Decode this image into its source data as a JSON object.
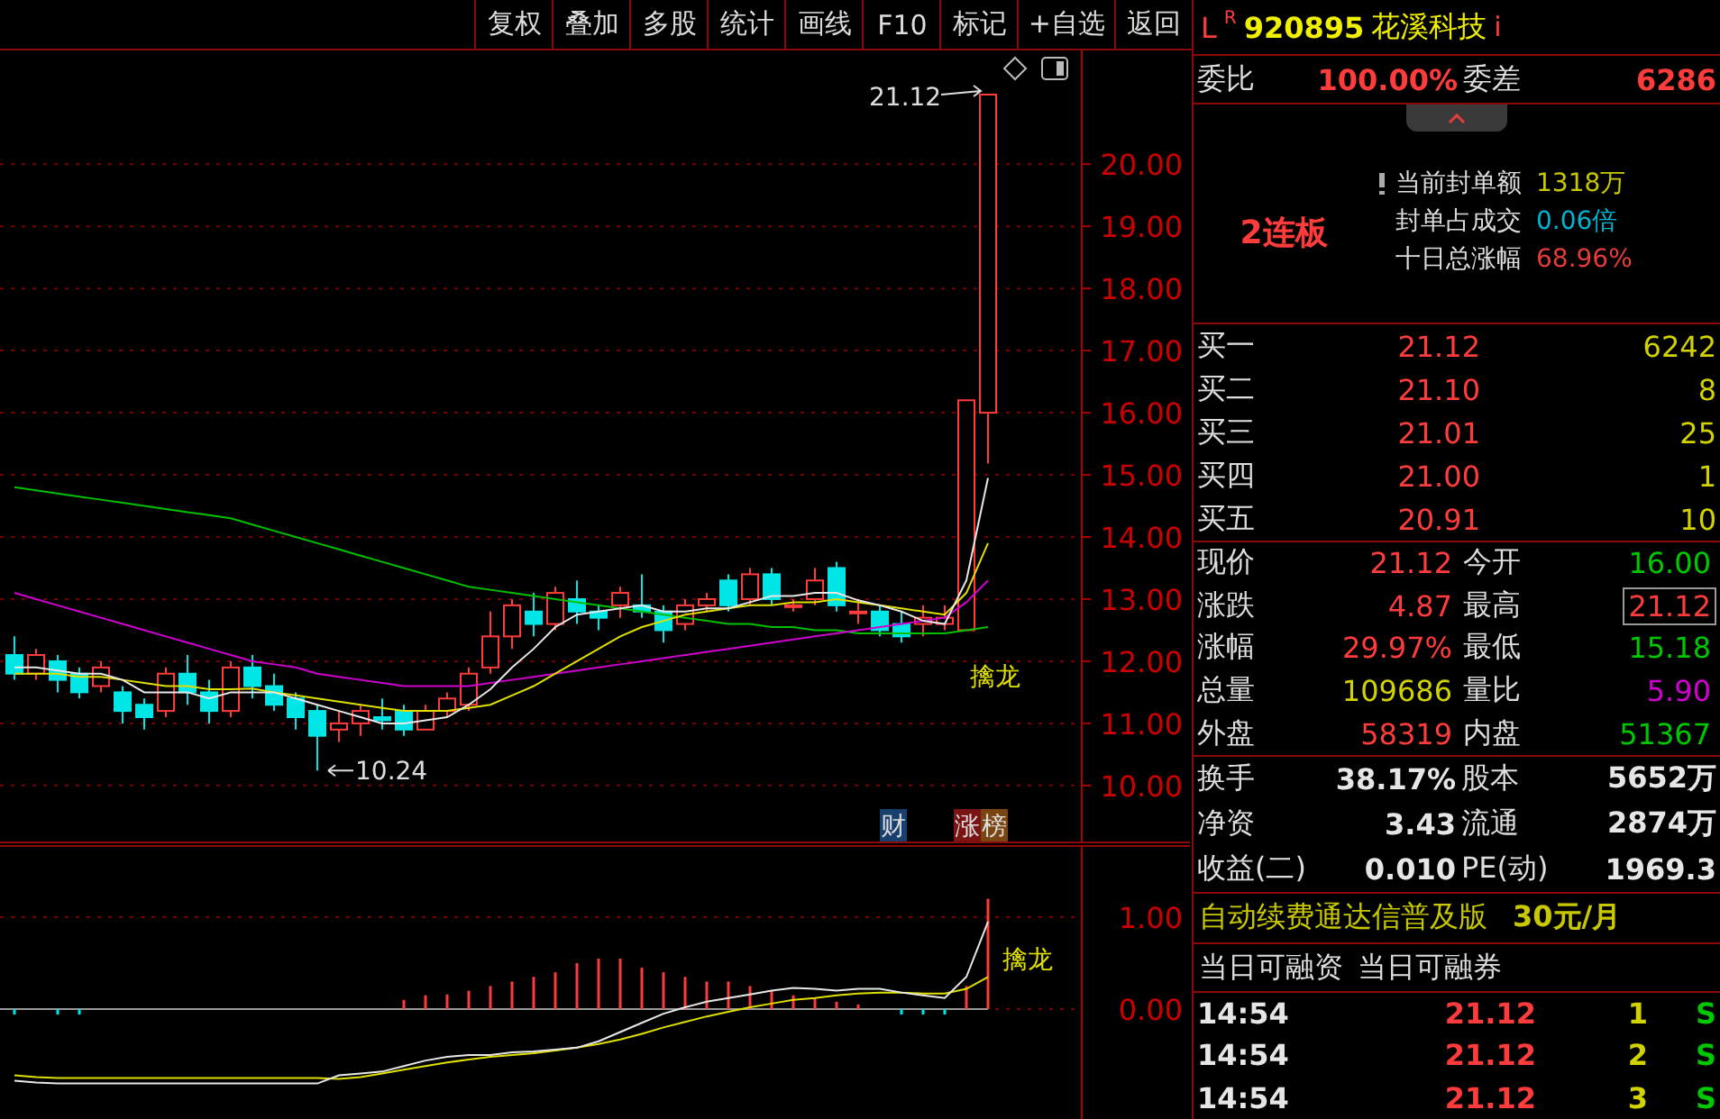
{
  "toolbar": {
    "buttons": [
      "复权",
      "叠加",
      "多股",
      "统计",
      "画线",
      "F10",
      "标记",
      "+自选",
      "返回"
    ]
  },
  "main_chart": {
    "high_label": "21.12",
    "low_label": "10.24",
    "signal": "擒龙",
    "badges": [
      {
        "text": "财",
        "color": "#17406e"
      },
      {
        "text": "涨",
        "color": "#7a1414"
      },
      {
        "text": "榜",
        "color": "#7a4510"
      }
    ],
    "chart_data": {
      "type": "candlestick",
      "ylim": [
        9.07,
        21.83
      ],
      "grid": true,
      "yticks": [
        {
          "value": 20,
          "label": "20.00"
        },
        {
          "value": 19,
          "label": "19.00"
        },
        {
          "value": 18,
          "label": "18.00"
        },
        {
          "value": 17,
          "label": "17.00"
        },
        {
          "value": 16,
          "label": "16.00"
        },
        {
          "value": 15,
          "label": "15.00"
        },
        {
          "value": 14,
          "label": "14.00"
        },
        {
          "value": 13,
          "label": "13.00"
        },
        {
          "value": 12,
          "label": "12.00"
        },
        {
          "value": 11,
          "label": "11.00"
        },
        {
          "value": 10,
          "label": "10.00"
        }
      ],
      "ohlc": [
        [
          12.1,
          12.4,
          11.7,
          11.8
        ],
        [
          11.8,
          12.2,
          11.7,
          12.1
        ],
        [
          12.0,
          12.1,
          11.5,
          11.7
        ],
        [
          11.8,
          11.9,
          11.4,
          11.5
        ],
        [
          11.6,
          12.0,
          11.5,
          11.9
        ],
        [
          11.5,
          11.6,
          11.0,
          11.2
        ],
        [
          11.3,
          11.4,
          10.9,
          11.1
        ],
        [
          11.2,
          11.9,
          11.1,
          11.8
        ],
        [
          11.8,
          12.1,
          11.3,
          11.5
        ],
        [
          11.5,
          11.7,
          11.0,
          11.2
        ],
        [
          11.2,
          12.0,
          11.1,
          11.9
        ],
        [
          11.9,
          12.1,
          11.4,
          11.6
        ],
        [
          11.6,
          11.8,
          11.2,
          11.3
        ],
        [
          11.4,
          11.5,
          10.9,
          11.1
        ],
        [
          11.2,
          11.3,
          10.24,
          10.8
        ],
        [
          10.9,
          11.2,
          10.7,
          11.0
        ],
        [
          11.0,
          11.3,
          10.8,
          11.2
        ],
        [
          11.1,
          11.4,
          10.9,
          11.05
        ],
        [
          11.2,
          11.3,
          10.8,
          10.9
        ],
        [
          10.9,
          11.3,
          10.9,
          11.2
        ],
        [
          11.2,
          11.5,
          11.1,
          11.4
        ],
        [
          11.3,
          11.9,
          11.2,
          11.8
        ],
        [
          11.9,
          12.8,
          11.8,
          12.4
        ],
        [
          12.4,
          13.0,
          12.2,
          12.9
        ],
        [
          12.8,
          13.1,
          12.4,
          12.6
        ],
        [
          12.6,
          13.2,
          12.5,
          13.1
        ],
        [
          13.0,
          13.3,
          12.6,
          12.8
        ],
        [
          12.8,
          12.9,
          12.5,
          12.7
        ],
        [
          12.9,
          13.2,
          12.7,
          13.1
        ],
        [
          12.9,
          13.4,
          12.7,
          12.8
        ],
        [
          12.8,
          12.9,
          12.3,
          12.5
        ],
        [
          12.6,
          13.0,
          12.5,
          12.9
        ],
        [
          12.9,
          13.1,
          12.8,
          13.0
        ],
        [
          13.3,
          13.4,
          12.8,
          12.9
        ],
        [
          13.0,
          13.5,
          12.9,
          13.4
        ],
        [
          13.4,
          13.5,
          12.9,
          13.0
        ],
        [
          12.9,
          13.0,
          12.8,
          12.9
        ],
        [
          13.0,
          13.5,
          12.9,
          13.3
        ],
        [
          13.5,
          13.6,
          12.8,
          12.9
        ],
        [
          12.8,
          13.0,
          12.6,
          12.8
        ],
        [
          12.8,
          12.9,
          12.4,
          12.5
        ],
        [
          12.6,
          12.8,
          12.3,
          12.4
        ],
        [
          12.6,
          12.9,
          12.4,
          12.7
        ],
        [
          12.6,
          12.9,
          12.5,
          12.7
        ],
        [
          12.5,
          16.2,
          12.5,
          16.2
        ],
        [
          16.0,
          21.12,
          15.18,
          21.12
        ]
      ],
      "series": [
        {
          "type": "line",
          "color": "#00c000",
          "values": [
            14.8,
            14.75,
            14.7,
            14.65,
            14.6,
            14.55,
            14.5,
            14.45,
            14.4,
            14.35,
            14.3,
            14.2,
            14.1,
            14.0,
            13.9,
            13.8,
            13.7,
            13.6,
            13.5,
            13.4,
            13.3,
            13.2,
            13.15,
            13.1,
            13.05,
            13.0,
            12.95,
            12.9,
            12.85,
            12.8,
            12.75,
            12.7,
            12.65,
            12.6,
            12.6,
            12.55,
            12.55,
            12.5,
            12.5,
            12.45,
            12.45,
            12.45,
            12.45,
            12.45,
            12.5,
            12.55
          ]
        },
        {
          "type": "line",
          "color": "#d000d0",
          "values": [
            13.1,
            13.0,
            12.9,
            12.8,
            12.7,
            12.6,
            12.5,
            12.4,
            12.3,
            12.2,
            12.1,
            12.0,
            11.95,
            11.9,
            11.8,
            11.75,
            11.7,
            11.65,
            11.6,
            11.6,
            11.6,
            11.6,
            11.65,
            11.7,
            11.75,
            11.8,
            11.85,
            11.9,
            11.95,
            12.0,
            12.05,
            12.1,
            12.15,
            12.2,
            12.25,
            12.3,
            12.35,
            12.4,
            12.45,
            12.5,
            12.55,
            12.6,
            12.65,
            12.7,
            12.95,
            13.3
          ]
        },
        {
          "type": "line",
          "color": "#e0e000",
          "values": [
            11.8,
            11.8,
            11.8,
            11.75,
            11.75,
            11.7,
            11.65,
            11.6,
            11.6,
            11.55,
            11.55,
            11.56,
            11.5,
            11.45,
            11.4,
            11.35,
            11.3,
            11.25,
            11.2,
            11.2,
            11.2,
            11.25,
            11.3,
            11.45,
            11.6,
            11.8,
            12.0,
            12.2,
            12.4,
            12.55,
            12.65,
            12.75,
            12.8,
            12.85,
            12.9,
            12.9,
            12.95,
            12.95,
            13.0,
            12.95,
            12.9,
            12.85,
            12.8,
            12.75,
            13.1,
            13.9
          ]
        },
        {
          "type": "line",
          "color": "#e8e8e8",
          "values": [
            11.9,
            11.9,
            11.85,
            11.8,
            11.8,
            11.7,
            11.5,
            11.5,
            11.5,
            11.4,
            11.5,
            11.5,
            11.5,
            11.4,
            11.3,
            11.2,
            11.1,
            11.0,
            11.0,
            11.05,
            11.1,
            11.3,
            11.55,
            11.9,
            12.2,
            12.55,
            12.75,
            12.8,
            12.85,
            12.9,
            12.8,
            12.8,
            12.85,
            12.85,
            12.95,
            13.05,
            13.05,
            13.1,
            13.1,
            12.98,
            12.9,
            12.8,
            12.65,
            12.6,
            13.3,
            14.95
          ]
        }
      ]
    }
  },
  "sub_chart": {
    "signal": "擒龙",
    "chart_data": {
      "type": "line",
      "ylim": [
        -1.196,
        1.784
      ],
      "grid": true,
      "yticks": [
        {
          "value": 1,
          "label": "1.00"
        },
        {
          "value": 0,
          "label": "0.00"
        }
      ],
      "series": [
        {
          "type": "bar",
          "color": "#ff3c3c",
          "values": [
            null,
            null,
            null,
            null,
            null,
            null,
            null,
            null,
            null,
            null,
            null,
            null,
            null,
            null,
            null,
            null,
            null,
            null,
            0.1,
            0.15,
            0.16,
            0.2,
            0.25,
            0.3,
            0.35,
            0.4,
            0.5,
            0.55,
            0.55,
            0.45,
            0.4,
            0.35,
            0.3,
            0.3,
            0.25,
            0.2,
            0.15,
            0.12,
            0.08,
            0.05,
            null,
            null,
            null,
            null,
            0.25,
            1.2
          ]
        },
        {
          "type": "bar",
          "color": "#00e5e5",
          "values": [
            -0.06,
            null,
            -0.06,
            -0.06,
            null,
            null,
            null,
            null,
            null,
            null,
            null,
            null,
            null,
            null,
            null,
            null,
            null,
            null,
            null,
            null,
            null,
            null,
            null,
            null,
            null,
            null,
            null,
            null,
            null,
            null,
            null,
            null,
            null,
            null,
            null,
            null,
            null,
            null,
            null,
            null,
            null,
            -0.06,
            -0.06,
            -0.06,
            null,
            null
          ]
        },
        {
          "type": "line",
          "color": "#e0e000",
          "values": [
            -0.72,
            -0.74,
            -0.75,
            -0.75,
            -0.75,
            -0.75,
            -0.75,
            -0.75,
            -0.75,
            -0.75,
            -0.75,
            -0.75,
            -0.75,
            -0.75,
            -0.75,
            -0.76,
            -0.74,
            -0.7,
            -0.66,
            -0.62,
            -0.58,
            -0.55,
            -0.52,
            -0.5,
            -0.48,
            -0.45,
            -0.42,
            -0.38,
            -0.33,
            -0.27,
            -0.2,
            -0.14,
            -0.08,
            -0.03,
            0.02,
            0.06,
            0.1,
            0.12,
            0.15,
            0.17,
            0.18,
            0.18,
            0.17,
            0.17,
            0.22,
            0.35
          ]
        },
        {
          "type": "line",
          "color": "#e8e8e8",
          "values": [
            -0.78,
            -0.8,
            -0.81,
            -0.81,
            -0.81,
            -0.81,
            -0.81,
            -0.81,
            -0.81,
            -0.81,
            -0.81,
            -0.81,
            -0.81,
            -0.81,
            -0.81,
            -0.72,
            -0.7,
            -0.68,
            -0.62,
            -0.56,
            -0.52,
            -0.5,
            -0.5,
            -0.47,
            -0.46,
            -0.44,
            -0.42,
            -0.35,
            -0.25,
            -0.15,
            -0.05,
            0.02,
            0.08,
            0.12,
            0.16,
            0.2,
            0.23,
            0.22,
            0.2,
            0.22,
            0.22,
            0.18,
            0.15,
            0.12,
            0.35,
            0.95
          ]
        }
      ]
    }
  },
  "quote": {
    "market": "L",
    "flag": "R",
    "code": "920895",
    "name": "花溪科技",
    "info": "i"
  },
  "order_ratio": {
    "label": "委比",
    "value": "100.00%",
    "label2": "委差",
    "value2": "6286"
  },
  "limit_info": {
    "streak": "2连板",
    "items": [
      {
        "label": "当前封单额",
        "value": "1318万",
        "color": "#c8c800"
      },
      {
        "label": "封单占成交",
        "value": "0.06倍",
        "color": "#00b4d2"
      },
      {
        "label": "十日总涨幅",
        "value": "68.96%",
        "color": "#e83c3c"
      }
    ]
  },
  "bids": [
    {
      "label": "买一",
      "price": "21.12",
      "volume": "6242"
    },
    {
      "label": "买二",
      "price": "21.10",
      "volume": "8"
    },
    {
      "label": "买三",
      "price": "21.01",
      "volume": "25"
    },
    {
      "label": "买四",
      "price": "21.00",
      "volume": "1"
    },
    {
      "label": "买五",
      "price": "20.91",
      "volume": "10"
    }
  ],
  "stats": [
    {
      "label": "现价",
      "value": "21.12",
      "color": "#ff3c3c",
      "boxed": false
    },
    {
      "label": "今开",
      "value": "16.00",
      "color": "#00c800",
      "boxed": false
    },
    {
      "label": "涨跌",
      "value": "4.87",
      "color": "#ff3c3c",
      "boxed": false
    },
    {
      "label": "最高",
      "value": "21.12",
      "color": "#ff3c3c",
      "boxed": true
    },
    {
      "label": "涨幅",
      "value": "29.97%",
      "color": "#ff3c3c",
      "boxed": false
    },
    {
      "label": "最低",
      "value": "15.18",
      "color": "#00c800",
      "boxed": false
    },
    {
      "label": "总量",
      "value": "109686",
      "color": "#d2d200",
      "boxed": false
    },
    {
      "label": "量比",
      "value": "5.90",
      "color": "#d000d0",
      "boxed": false
    },
    {
      "label": "外盘",
      "value": "58319",
      "color": "#ff3c3c",
      "boxed": false
    },
    {
      "label": "内盘",
      "value": "51367",
      "color": "#00c800",
      "boxed": false
    }
  ],
  "finance": [
    {
      "label": "换手",
      "value": "38.17%",
      "label2": "股本",
      "value2": "5652万"
    },
    {
      "label": "净资",
      "value": "3.43",
      "label2": "流通",
      "value2": "2874万"
    },
    {
      "label": "收益(二)",
      "value": "0.010",
      "label2": "PE(动)",
      "value2": "1969.3"
    }
  ],
  "promo": {
    "text": "自动续费通达信普及版",
    "price": "30元/月"
  },
  "margin": [
    "当日可融资",
    "当日可融券"
  ],
  "ticks": [
    {
      "time": "14:54",
      "price": "21.12",
      "volume": "1",
      "side": "S"
    },
    {
      "time": "14:54",
      "price": "21.12",
      "volume": "2",
      "side": "S"
    },
    {
      "time": "14:54",
      "price": "21.12",
      "volume": "3",
      "side": "S"
    }
  ]
}
